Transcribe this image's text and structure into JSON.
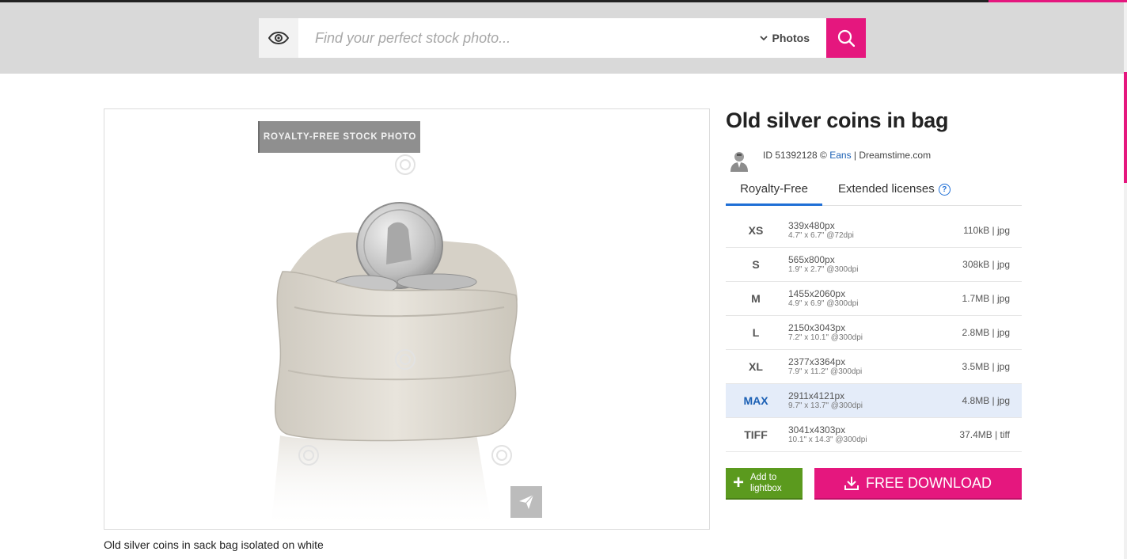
{
  "search": {
    "placeholder": "Find your perfect stock photo...",
    "type_label": "Photos"
  },
  "photo": {
    "badge": "ROYALTY-FREE STOCK PHOTO",
    "caption": "Old silver coins in sack bag isolated on white"
  },
  "details": {
    "title": "Old silver coins in bag",
    "id_text": "ID 51392128 © ",
    "author": "Eans",
    "site_text": " | Dreamstime.com"
  },
  "tabs": {
    "royalty": "Royalty-Free",
    "extended": "Extended licenses",
    "help": "?"
  },
  "sizes": [
    {
      "code": "XS",
      "px": "339x480px",
      "dpi": "4.7\" x 6.7\" @72dpi",
      "file": "110kB | jpg"
    },
    {
      "code": "S",
      "px": "565x800px",
      "dpi": "1.9\" x 2.7\" @300dpi",
      "file": "308kB | jpg"
    },
    {
      "code": "M",
      "px": "1455x2060px",
      "dpi": "4.9\" x 6.9\" @300dpi",
      "file": "1.7MB | jpg"
    },
    {
      "code": "L",
      "px": "2150x3043px",
      "dpi": "7.2\" x 10.1\" @300dpi",
      "file": "2.8MB | jpg"
    },
    {
      "code": "XL",
      "px": "2377x3364px",
      "dpi": "7.9\" x 11.2\" @300dpi",
      "file": "3.5MB | jpg"
    },
    {
      "code": "MAX",
      "px": "2911x4121px",
      "dpi": "9.7\" x 13.7\" @300dpi",
      "file": "4.8MB | jpg",
      "selected": true
    },
    {
      "code": "TIFF",
      "px": "3041x4303px",
      "dpi": "10.1\" x 14.3\" @300dpi",
      "file": "37.4MB | tiff"
    }
  ],
  "actions": {
    "lightbox_line1": "Add to",
    "lightbox_line2": "lightbox",
    "download": "FREE DOWNLOAD"
  },
  "colors": {
    "accent": "#e5177e",
    "link": "#1a5fb4",
    "lightbox": "#5b9a1e"
  }
}
